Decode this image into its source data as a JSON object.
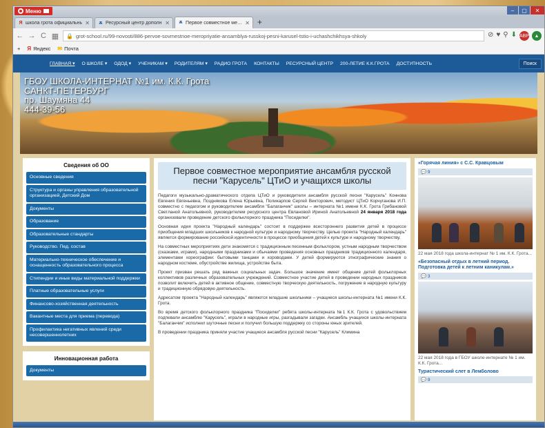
{
  "browser": {
    "menu_label": "Меню",
    "tabs": [
      {
        "label": "школа грота официальнь",
        "icon": "yandex-icon"
      },
      {
        "label": "Ресурсный центр дополн",
        "icon": "school-icon"
      },
      {
        "label": "Первое совместное мероп",
        "icon": "school-icon"
      }
    ],
    "new_tab": "+",
    "url": "grot-school.ru/99-novosti/886-pervoe-sovmestnoe-meropriyatie-ansamblya-russkoj-pesni-karusel-tstio-i-uchashchikhsya-shkoly",
    "bookmarks": [
      {
        "label": "Яндекс",
        "icon": "Я"
      },
      {
        "label": "Почта",
        "icon": "✉"
      }
    ]
  },
  "site": {
    "nav": [
      "ГЛАВНАЯ ▾",
      "О ШКОЛЕ ▾",
      "ОДОД ▾",
      "УЧЕНИКАМ ▾",
      "РОДИТЕЛЯМ ▾",
      "РАДИО ГРОТА",
      "КОНТАКТЫ",
      "РЕСУРСНЫЙ ЦЕНТР",
      "200-ЛЕТИЕ К.К.ГРОТА",
      "ДОСТУПНОСТЬ"
    ],
    "search_label": "Поиск",
    "banner_lines": [
      "ГБОУ ШКОЛА-ИНТЕРНАТ №1 им. К.К. Грота",
      "САНКТ-ПЕТЕРБУРГ",
      "пр. Шаумяна 44",
      "444-39-56"
    ]
  },
  "sidebar": {
    "title": "Сведения об ОО",
    "items": [
      "Основные сведения",
      "Структура и органы управления образовательной организацией, Детский Дом",
      "Документы",
      "Образование",
      "Образовательные стандарты",
      "Руководство. Пед. состав",
      "Материально-техническое обеспечение и оснащенность образовательного процесса",
      "Стипендии и иные виды материальной поддержки",
      "Платные образовательные услуги",
      "Финансово-хозяйственная деятельность",
      "Вакантные места для приема (перевода)",
      "Профилактика негативных явлений среди несовершеннолетних"
    ],
    "panel2_title": "Инновационная работа",
    "panel2_items": [
      "Документы"
    ]
  },
  "article": {
    "title": "Первое совместное мероприятие ансамбля русской песни \"Карусель\" ЦТиО и учащихся школы",
    "p1_before": "Педагоги музыкально-драматического отдела ЦТиО и руководители ансамбля русской песни \"Карусель\" Коннова Евгения Евгеньевна, Позднякова Елена Юрьевна, Поликарпов Сергей Викторович, методист ЦТиО Корчуганова И.П. совместно с педагогом и руководителем ансамбля \"Балаганчик\" школы – интерната №1 имени К.К. Грота Грибановой Светланой Анатольевной, руководителем ресурсного центра Евлановой Ириной Анатольевной",
    "p1_bold": "24 января 2018 года",
    "p1_after": "организовали проведение детского фольклорного праздника \"Посиделки\".",
    "p2": "Основная идея проекта \"Народный календарь\" состоит в поддержке всестороннего развития детей в процессе приобщения младших школьников к народной культуре и народному творчеству. Целью проекта \"Народный календарь\" является формирование российской идентичности в процессе приобщения детей к культуре и народному творчеству.",
    "p3": "На совместных мероприятиях дети знакомятся с традиционным песенным фольклором, устным народным творчеством (сказками, играми), народными праздниками и обычаями проведения основных праздников традиционного календаря, элементами хореографии: бытовыми танцами и хороводами. У детей формируются этнографические знания о народном костюме, обустройстве жилища, устройстве быта.",
    "p4": "Проект призван решать ряд важных социальных задач. Большое значение имеет общение детей фольклорных коллективов различных образовательных учреждений. Совместное участие детей в проведении народных праздников позволит включить детей в активное общение, совместную творческую деятельность, погружение в народную культуру и традиционную обрядовую деятельность.",
    "p5": "Адресатом проекта \"Народный календарь\" являются младшие школьники – учащиеся школы-интерната №1 имени К.К. Грота.",
    "p6": "Во время детского фольклорного праздника \"Посиделки\" ребята школы-интерната №1 К.К. Грота с удовольствием подпевали ансамблю \"Карусель\", играли в народные игры, разгадывали загадки. Ансамбль учащихся школы-интерната \"Балаганчик\" исполнил шуточные песни и получил большую поддержку со стороны юных зрителей.",
    "p7": "В проведении праздника приняли участие учащиеся ансамбля русской песни \"Карусель\" Климина"
  },
  "news": [
    {
      "title": "«Горячая линия» с С.С. Кравцовым",
      "comments": "9",
      "meta": "22 мая 2018 года школа-интернат № 1 им. К.К. Грота..."
    },
    {
      "title": "«Безопасный отдых в летний период. Подготовка детей к летним каникулам.»",
      "comments": "3",
      "meta": "22 мая 2018 года в ГБОУ школе-интернате № 1 им. К.К. Грота..."
    },
    {
      "title": "Туристический слет в Лемболово",
      "comments": "9",
      "meta": ""
    }
  ],
  "colors": {
    "nav_blue": "#1d5a98",
    "link_blue": "#1b6aa8",
    "title_bg": "#d6e6f3"
  }
}
